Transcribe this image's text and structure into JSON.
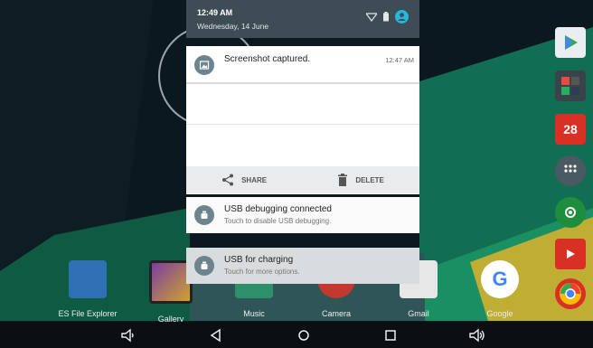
{
  "status": {
    "time": "12:49 AM",
    "date": "Wednesday, 14 June"
  },
  "notifications": [
    {
      "title": "Screenshot captured.",
      "time": "12:47 AM"
    },
    {
      "title": "USB debugging connected",
      "subtitle": "Touch to disable USB debugging."
    },
    {
      "title": "USB for charging",
      "subtitle": "Touch for more options."
    }
  ],
  "actions": {
    "share": "SHARE",
    "delete": "DELETE"
  },
  "dock": [
    {
      "label": "ES File Explorer"
    },
    {
      "label": "Gallery"
    },
    {
      "label": "Music"
    },
    {
      "label": "Camera"
    },
    {
      "label": "Gmail"
    },
    {
      "label": "Google"
    }
  ],
  "rail": {
    "calendar_day": "28"
  },
  "colors": {
    "header": "#3d4c55",
    "card": "#fafafa",
    "icon_circle": "#6d848f",
    "wallpaper_green": "#148c5e",
    "wallpaper_yellow": "#c9b72e"
  },
  "nav": [
    "volume-down-icon",
    "back-icon",
    "home-icon",
    "recents-icon",
    "volume-up-icon"
  ]
}
